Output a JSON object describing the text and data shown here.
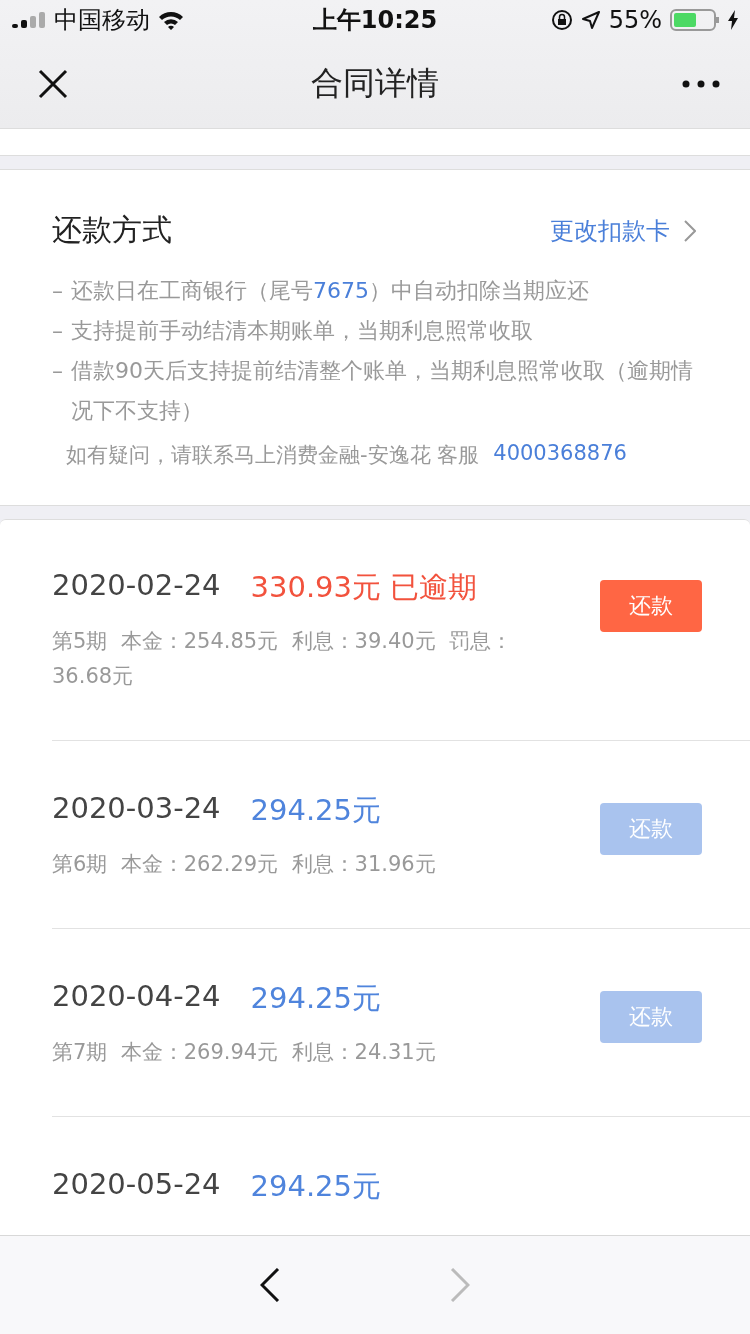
{
  "status_bar": {
    "carrier": "中国移动",
    "time": "上午10:25",
    "battery": "55%"
  },
  "nav": {
    "title": "合同详情"
  },
  "repayment_method": {
    "title": "还款方式",
    "action": "更改扣款卡",
    "rules": [
      {
        "bullet": "–",
        "text": "还款日在工商银行（尾号**7675**）中自动扣除当期应还"
      },
      {
        "bullet": "–",
        "text": "支持提前手动结清本期账单，当期利息照常收取"
      },
      {
        "bullet": "–",
        "text": "借款90天后支持提前结清整个账单，当期利息照常收取（逾期情况下不支持）"
      }
    ],
    "contact": "如有疑问，请联系马上消费金融-安逸花 客服",
    "phone": "4000368876"
  },
  "installments": [
    {
      "date": "2020-02-24",
      "amount": "330.93元",
      "status": "已逾期",
      "overdue": true,
      "detail": "第5期  本金：254.85元  利息：39.40元  罚息：36.68元",
      "button": "还款",
      "disabled": false
    },
    {
      "date": "2020-03-24",
      "amount": "294.25元",
      "overdue": false,
      "detail": "第6期  本金：262.29元  利息：31.96元",
      "button": "还款",
      "disabled": true
    },
    {
      "date": "2020-04-24",
      "amount": "294.25元",
      "overdue": false,
      "detail": "第7期  本金：269.94元  利息：24.31元",
      "button": "还款",
      "disabled": true
    },
    {
      "date": "2020-05-24",
      "amount": "294.25元",
      "overdue": false
    }
  ],
  "bottom_bar": {
    "back_disabled": false,
    "forward_disabled": true
  }
}
